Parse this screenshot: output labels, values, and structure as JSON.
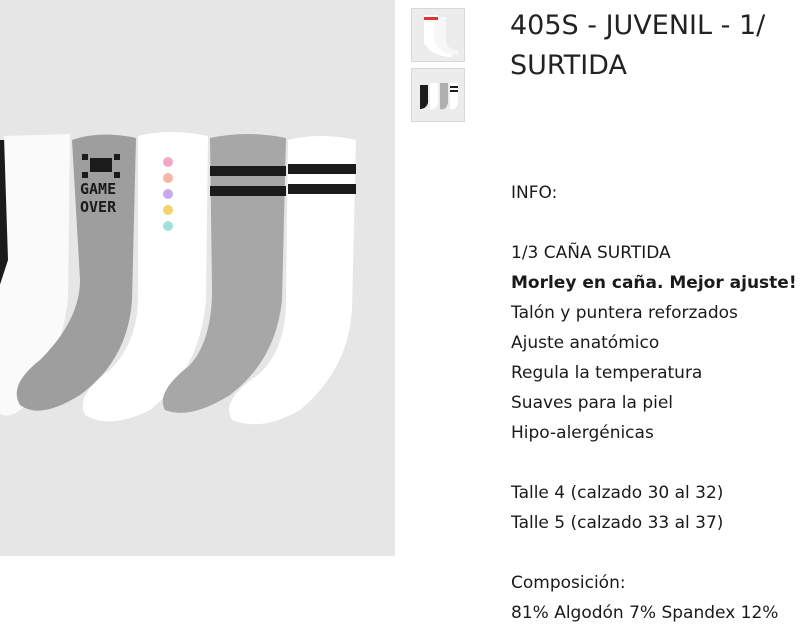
{
  "product": {
    "title_line1": "405S - JUVENIL - 1/",
    "title_line2": "SURTIDA"
  },
  "image": {
    "main_alt": "socks-product-photo",
    "sock_print_text_1": "GAME",
    "sock_print_text_2": "OVER"
  },
  "thumbnails": [
    {
      "name": "thumb-white-socks"
    },
    {
      "name": "thumb-striped-socks"
    }
  ],
  "info": {
    "heading": "INFO:",
    "lines": [
      "1/3 CAÑA SURTIDA",
      "Morley en caña. Mejor ajuste!",
      "Talón y puntera reforzados",
      "Ajuste anatómico",
      "Regula la temperatura",
      "Suaves para la piel",
      "Hipo-alergénicas"
    ],
    "sizes": [
      "Talle 4 (calzado 30 al 32)",
      "Talle 5 (calzado 33 al 37)"
    ],
    "composition_label": "Composición:",
    "composition_value": "81% Algodón 7% Spandex 12%"
  },
  "colors": {
    "image_bg": "#e6e6e6",
    "sock_white": "#ffffff",
    "sock_gray": "#a9a9a9",
    "sock_black": "#1b1b1b",
    "text": "#1a1a1a"
  }
}
